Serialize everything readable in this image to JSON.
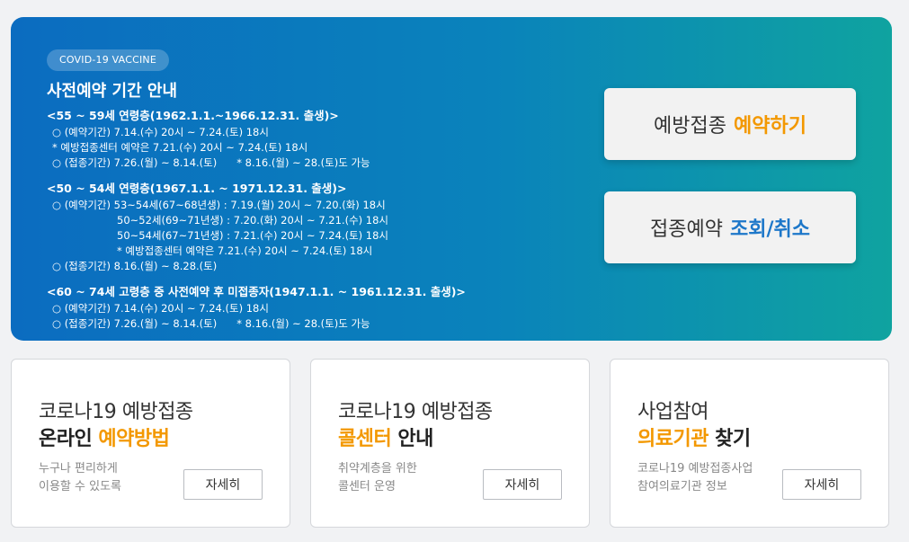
{
  "hero": {
    "badge": "COVID-19 VACCINE",
    "title": "사전예약 기간 안내",
    "groups": [
      {
        "heading": "<55 ~ 59세 연령층(1962.1.1.~1966.12.31. 출생)>",
        "lines": [
          "○ (예약기간) 7.14.(수) 20시 ~ 7.24.(토) 18시",
          "* 예방접종센터 예약은 7.21.(수) 20시 ~ 7.24.(토) 18시",
          "○ (접종기간) 7.26.(월) ~ 8.14.(토)",
          "* 8.16.(월) ~ 28.(토)도 가능"
        ]
      },
      {
        "heading": "<50 ~ 54세 연령층(1967.1.1. ~ 1971.12.31. 출생)>",
        "lines": [
          "○ (예약기간) 53~54세(67~68년생) : 7.19.(월) 20시 ~ 7.20.(화) 18시",
          "50~52세(69~71년생) : 7.20.(화) 20시 ~ 7.21.(수) 18시",
          "50~54세(67~71년생) : 7.21.(수) 20시 ~ 7.24.(토) 18시",
          "* 예방접종센터 예약은 7.21.(수) 20시 ~ 7.24.(토) 18시",
          "○ (접종기간) 8.16.(월) ~ 8.28.(토)"
        ]
      },
      {
        "heading": "<60 ~ 74세 고령층 중 사전예약 후 미접종자(1947.1.1. ~ 1961.12.31. 출생)>",
        "lines": [
          "○ (예약기간) 7.14.(수) 20시 ~ 7.24.(토) 18시",
          "○ (접종기간) 7.26.(월) ~ 8.14.(토)",
          "* 8.16.(월) ~ 28.(토)도 가능"
        ]
      }
    ],
    "cta_reserve": {
      "label": "예방접종",
      "accent": "예약하기",
      "accent_color": "#f39800"
    },
    "cta_inquiry": {
      "label": "접종예약",
      "accent": "조회/취소",
      "accent_color": "#1d77c9"
    }
  },
  "cards": [
    {
      "line1": "코로나19 예방접종",
      "line2_plain": "온라인 ",
      "line2_accent": "예약방법",
      "desc1": "누구나 편리하게",
      "desc2": "이용할 수 있도록",
      "button": "자세히"
    },
    {
      "line1": "코로나19 예방접종",
      "line2_accent": "콜센터",
      "line2_plain": " 안내",
      "desc1": "취약계층을 위한",
      "desc2": "콜센터 운영",
      "button": "자세히"
    },
    {
      "line1": "사업참여",
      "line2_accent": "의료기관",
      "line2_plain": " 찾기",
      "desc1": "코로나19 예방접종사업",
      "desc2": "참여의료기관 정보",
      "button": "자세히"
    }
  ],
  "colors": {
    "accent_orange": "#f39800",
    "accent_blue": "#1d77c9",
    "hero_start": "#0b6cc0",
    "hero_end": "#0fa3a0"
  }
}
